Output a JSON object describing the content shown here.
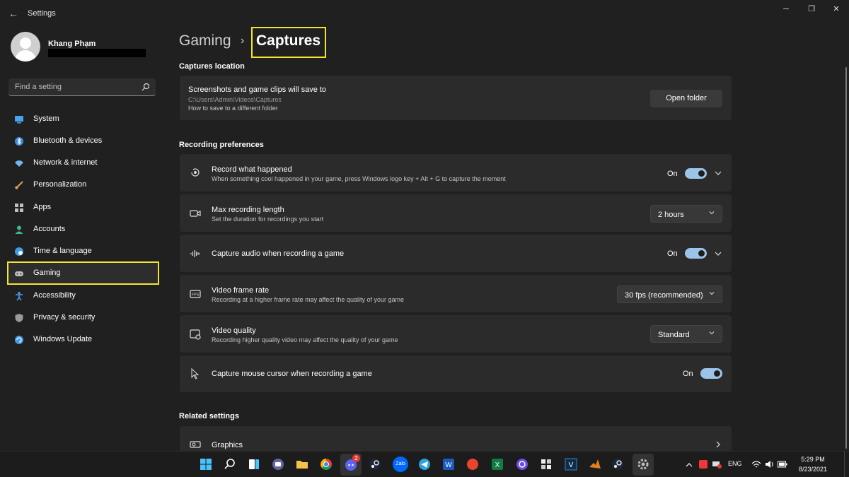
{
  "window": {
    "app_title": "Settings",
    "back": "←",
    "minimize": "─",
    "maximize": "❐",
    "close": "✕"
  },
  "user": {
    "name": "Khang Phạm"
  },
  "search": {
    "placeholder": "Find a setting"
  },
  "sidebar": {
    "items": [
      {
        "label": "System",
        "icon": "system-icon",
        "color": "#4aa3f0"
      },
      {
        "label": "Bluetooth & devices",
        "icon": "bluetooth-icon",
        "color": "#3b8ee0"
      },
      {
        "label": "Network & internet",
        "icon": "wifi-icon",
        "color": "#6fb6f2"
      },
      {
        "label": "Personalization",
        "icon": "brush-icon",
        "color": "#e0a050"
      },
      {
        "label": "Apps",
        "icon": "apps-icon",
        "color": "#bfbfbf"
      },
      {
        "label": "Accounts",
        "icon": "accounts-icon",
        "color": "#3fb98a"
      },
      {
        "label": "Time & language",
        "icon": "globe-icon",
        "color": "#3f9be6"
      },
      {
        "label": "Gaming",
        "icon": "gamepad-icon",
        "color": "#bfbfbf"
      },
      {
        "label": "Accessibility",
        "icon": "accessibility-icon",
        "color": "#4aa3f0"
      },
      {
        "label": "Privacy & security",
        "icon": "shield-icon",
        "color": "#9a9a9a"
      },
      {
        "label": "Windows Update",
        "icon": "update-icon",
        "color": "#3f9be6"
      }
    ],
    "active": "Gaming"
  },
  "breadcrumb": {
    "parent": "Gaming",
    "separator": "›",
    "current": "Captures"
  },
  "captures_location": {
    "section_title": "Captures location",
    "title": "Screenshots and game clips will save to",
    "path": "C:\\Users\\Admin\\Videos\\Captures",
    "help_link": "How to save to a different folder",
    "open_folder_label": "Open folder"
  },
  "recording": {
    "section_title": "Recording preferences",
    "record_what_happened": {
      "title": "Record what happened",
      "subtitle": "When something cool happened in your game, press Windows logo key + Alt + G to capture the moment",
      "state": "On"
    },
    "max_length": {
      "title": "Max recording length",
      "subtitle": "Set the duration for recordings you start",
      "value": "2 hours"
    },
    "capture_audio": {
      "title": "Capture audio when recording a game",
      "state": "On"
    },
    "frame_rate": {
      "title": "Video frame rate",
      "subtitle": "Recording at a higher frame rate may affect the quality of your game",
      "value": "30 fps (recommended)"
    },
    "quality": {
      "title": "Video quality",
      "subtitle": "Recording higher quality video may affect the quality of your game",
      "value": "Standard"
    },
    "mouse_cursor": {
      "title": "Capture mouse cursor when recording a game",
      "state": "On"
    }
  },
  "related": {
    "section_title": "Related settings",
    "graphics": "Graphics"
  },
  "taskbar": {
    "discord_badge": "2",
    "zalo_label": "Zalo",
    "language": "ENG",
    "time": "5:29 PM",
    "date": "8/23/2021"
  },
  "colors": {
    "accent": "#9bc4e8",
    "highlight": "#f2e52e",
    "background": "#202020",
    "card": "#2b2b2b"
  }
}
